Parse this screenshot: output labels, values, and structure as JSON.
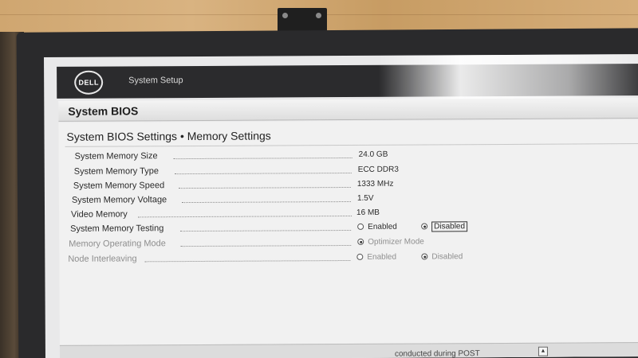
{
  "header": {
    "logo_text": "DELL",
    "app_title": "System Setup"
  },
  "section": {
    "title": "System BIOS"
  },
  "panel": {
    "title": "System BIOS Settings • Memory Settings",
    "rows": [
      {
        "label": "System Memory Size",
        "value": "24.0 GB"
      },
      {
        "label": "System Memory Type",
        "value": "ECC DDR3"
      },
      {
        "label": "System Memory Speed",
        "value": "1333 MHz"
      },
      {
        "label": "System Memory Voltage",
        "value": "1.5V"
      },
      {
        "label": "Video Memory",
        "value": "16 MB"
      },
      {
        "label": "System Memory Testing",
        "options": [
          "Enabled",
          "Disabled"
        ],
        "selected": "Disabled"
      },
      {
        "label": "Memory Operating Mode",
        "options": [
          "Optimizer Mode"
        ],
        "selected": "Optimizer Mode"
      },
      {
        "label": "Node Interleaving",
        "options": [
          "Enabled",
          "Disabled"
        ],
        "selected": "Disabled"
      }
    ]
  },
  "footer": {
    "help_text": "conducted during POST"
  },
  "icons": {
    "scroll_up": "scroll-up-icon"
  }
}
